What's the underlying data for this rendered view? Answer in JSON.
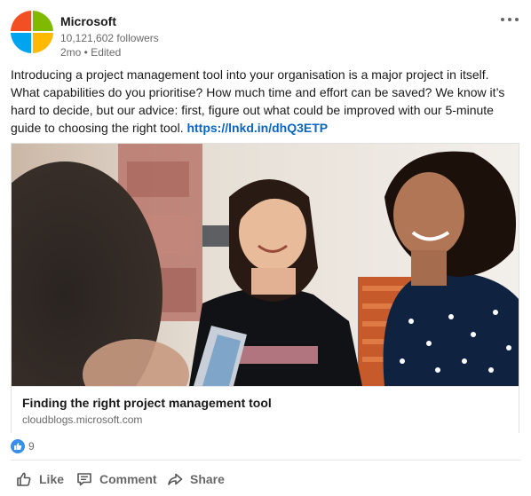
{
  "author": {
    "name": "Microsoft",
    "followers": "10,121,602 followers",
    "meta": "2mo • Edited"
  },
  "post": {
    "text": "Introducing a project management tool into your organisation is a major project in itself. What capabilities do you prioritise? How much time and effort can be saved? We know it’s hard to decide, but our advice: first, figure out what could be improved with our 5-minute guide to choosing the right tool. ",
    "link": "https://lnkd.in/dhQ3ETP"
  },
  "article": {
    "title": "Finding the right project management tool",
    "domain": "cloudblogs.microsoft.com"
  },
  "social": {
    "reaction_count": "9"
  },
  "actions": {
    "like": "Like",
    "comment": "Comment",
    "share": "Share"
  },
  "colors": {
    "brand_red": "#f25022",
    "brand_green": "#7fba00",
    "brand_blue": "#00a4ef",
    "brand_yellow": "#ffb900",
    "link": "#0a66c2",
    "like_badge": "#378fe9"
  },
  "icons": [
    "microsoft-logo",
    "more-options-icon",
    "thumbs-up-icon",
    "like-icon",
    "comment-icon",
    "share-icon"
  ]
}
